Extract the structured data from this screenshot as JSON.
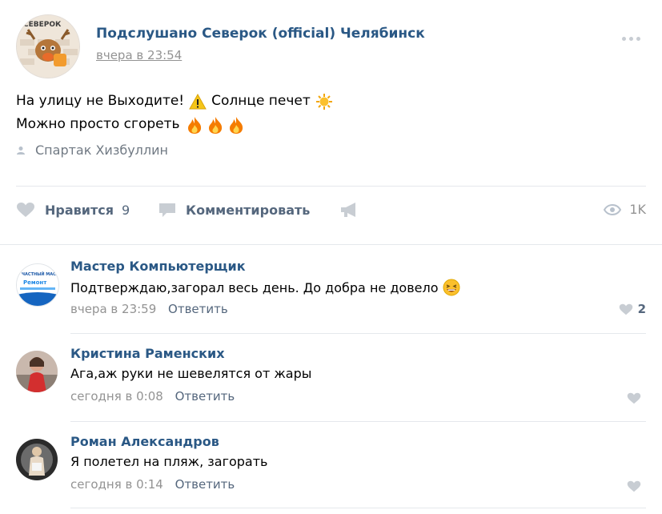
{
  "post": {
    "group_name": "Подслушано Северок (official) Челябинск",
    "avatar_label": "СЕВЕРОК",
    "time": "вчера в 23:54",
    "text_line1": "На улицу не Выходите!",
    "text_line1b": "Солнце печет",
    "text_line2": "Можно просто сгореть",
    "signer": "Спартак Хизбуллин"
  },
  "actions": {
    "like_label": "Нравится",
    "like_count": "9",
    "comment_label": "Комментировать",
    "views": "1K"
  },
  "comments": [
    {
      "author": "Мастер Компьютерщик",
      "text": "Подтверждаю,загорал весь день. До добра не довело",
      "time": "вчера в 23:59",
      "reply": "Ответить",
      "likes": "2",
      "avatar_text1": "ЧАСТНЫЙ МАСТЕР",
      "avatar_text2": "Ремонт"
    },
    {
      "author": "Кристина Раменских",
      "text": "Ага,аж руки не шевелятся от жары",
      "time": "сегодня в 0:08",
      "reply": "Ответить",
      "likes": ""
    },
    {
      "author": "Роман Александров",
      "text": "Я полетел на пляж, загорать",
      "time": "сегодня в 0:14",
      "reply": "Ответить",
      "likes": ""
    }
  ],
  "icons": {
    "warning": "warning-icon",
    "sun": "sun-icon",
    "fire": "fire-icon",
    "heart": "heart-icon",
    "comment": "comment-icon",
    "share": "megaphone-icon",
    "eye": "eye-icon",
    "more": "more-icon"
  },
  "colors": {
    "link": "#2a5885",
    "action": "#55677d",
    "muted": "#939393",
    "icon": "#c8cdd3"
  }
}
